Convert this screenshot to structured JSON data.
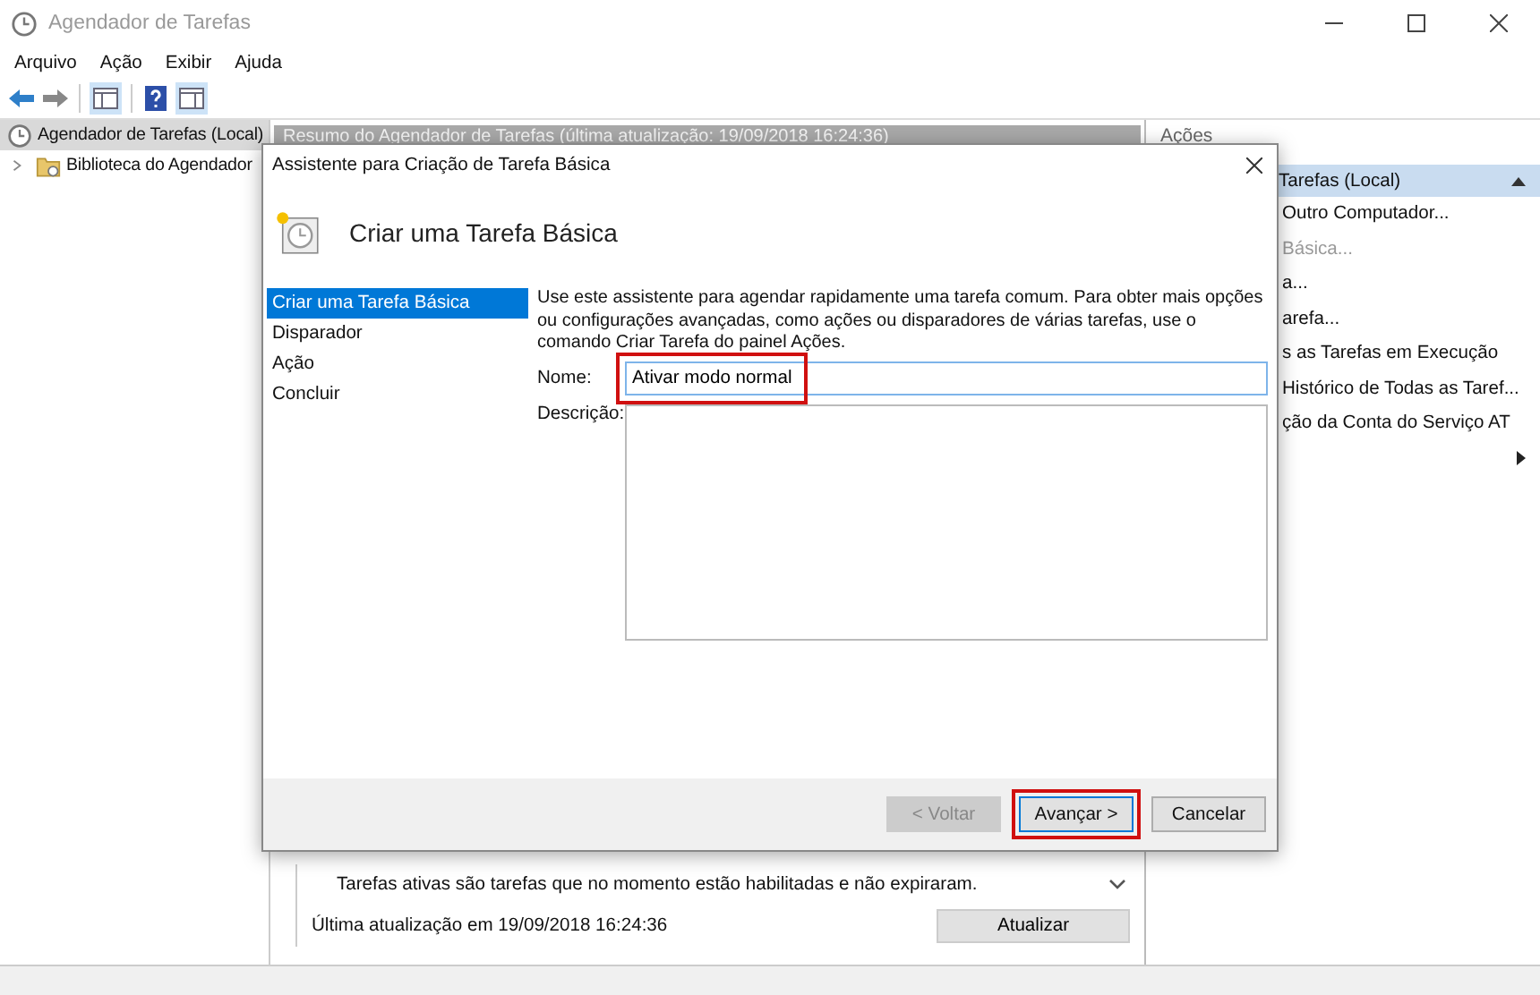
{
  "window": {
    "title": "Agendador de Tarefas"
  },
  "menu": [
    "Arquivo",
    "Ação",
    "Exibir",
    "Ajuda"
  ],
  "tree": [
    {
      "label": "Agendador de Tarefas (Local)",
      "selected": true,
      "children": [
        {
          "label": "Biblioteca do Agendador",
          "selected": false,
          "expanded": false
        }
      ]
    }
  ],
  "summary": {
    "header": "Resumo do Agendador de Tarefas (última atualização: 19/09/2018 16:24:36)",
    "note": "Tarefas ativas são tarefas que no momento estão habilitadas e não expiraram.",
    "last_update": "Última atualização em 19/09/2018 16:24:36",
    "refresh_button": "Atualizar"
  },
  "actions": {
    "header": "Ações",
    "items": [
      {
        "kind": "section",
        "label": "Tarefas (Local)"
      },
      {
        "kind": "item",
        "label": "Outro Computador...",
        "disabled": false
      },
      {
        "kind": "item",
        "label": "Básica...",
        "disabled": true
      },
      {
        "kind": "item",
        "label": "a...",
        "disabled": false
      },
      {
        "kind": "item",
        "label": "arefa...",
        "disabled": false
      },
      {
        "kind": "item",
        "label": "s as Tarefas em Execução",
        "disabled": false
      },
      {
        "kind": "item",
        "label": "Histórico de Todas as Taref...",
        "disabled": false
      },
      {
        "kind": "item",
        "label": "ção da Conta do Serviço AT",
        "disabled": false
      },
      {
        "kind": "submenu"
      }
    ]
  },
  "dialog": {
    "title": "Assistente para Criação de Tarefa Básica",
    "heading": "Criar uma Tarefa Básica",
    "steps": [
      {
        "label": "Criar uma Tarefa Básica",
        "selected": true
      },
      {
        "label": "Disparador",
        "selected": false
      },
      {
        "label": "Ação",
        "selected": false
      },
      {
        "label": "Concluir",
        "selected": false
      }
    ],
    "intro": "Use este assistente para agendar rapidamente uma tarefa comum. Para obter mais opções ou configurações avançadas, como ações ou disparadores de várias tarefas, use o comando Criar Tarefa do painel Ações.",
    "name_label": "Nome:",
    "name_value": "Ativar modo normal",
    "name_highlighted": true,
    "description_label": "Descrição:",
    "buttons": [
      {
        "label": "< Voltar",
        "disabled": true,
        "highlighted": false
      },
      {
        "label": "Avançar >",
        "disabled": false,
        "highlighted": true
      },
      {
        "label": "Cancelar",
        "disabled": false,
        "highlighted": false
      }
    ]
  }
}
